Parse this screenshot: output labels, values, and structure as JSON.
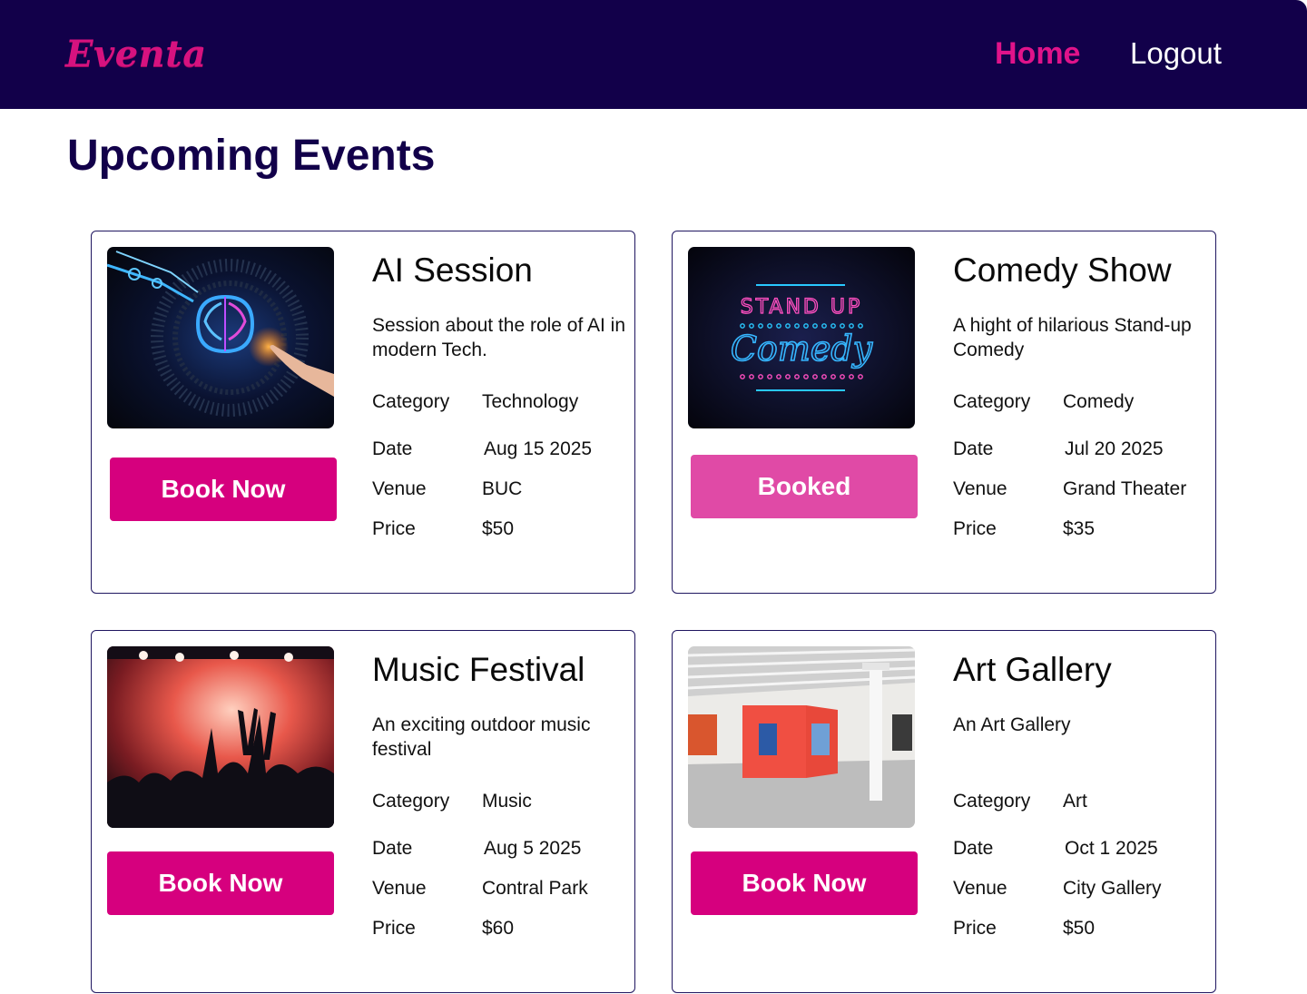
{
  "app": {
    "logo": "Eventa",
    "nav": {
      "home": "Home",
      "logout": "Logout"
    },
    "colors": {
      "navbar": "#12004a",
      "accent": "#d6007e",
      "booked": "#e04aa6"
    }
  },
  "page": {
    "title": "Upcoming Events"
  },
  "labels": {
    "category": "Category",
    "date": "Date",
    "venue": "Venue",
    "price": "Price"
  },
  "events": [
    {
      "title": "AI Session",
      "description": "Session about the role of AI in modern Tech.",
      "category": "Technology",
      "date": "Aug 15 2025",
      "venue": "BUC",
      "price": "$50",
      "button": "Book Now",
      "image": "ai-brain-image"
    },
    {
      "title": "Comedy Show",
      "description": "A hight of hilarious Stand-up Comedy",
      "category": "Comedy",
      "date": "Jul 20 2025",
      "venue": "Grand Theater",
      "price": "$35",
      "button": "Booked",
      "image": "neon-comedy-sign-image",
      "image_text": [
        "STAND UP",
        "Comedy"
      ]
    },
    {
      "title": "Music Festival",
      "description": "An exciting outdoor music festival",
      "category": "Music",
      "date": "Aug 5 2025",
      "venue": "Contral Park",
      "price": "$60",
      "button": "Book Now",
      "image": "concert-crowd-image"
    },
    {
      "title": "Art Gallery",
      "description": "An Art Gallery",
      "category": "Art",
      "date": "Oct 1 2025",
      "venue": "City Gallery",
      "price": "$50",
      "button": "Book Now",
      "image": "gallery-interior-image"
    }
  ]
}
